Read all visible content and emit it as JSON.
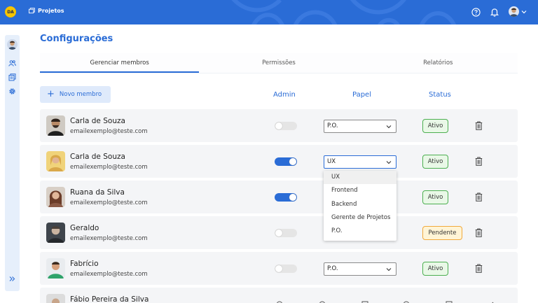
{
  "app": {
    "logo_text": "DA",
    "section": "Projetos"
  },
  "header": {
    "icons": [
      "help-circle-icon",
      "bell-icon",
      "user-avatar",
      "chevron-down-icon"
    ]
  },
  "sidebar": {
    "icons": [
      "user-avatar",
      "users-icon",
      "document-icon",
      "gear-icon",
      "double-chevron-right-icon"
    ]
  },
  "page": {
    "title": "Configurações"
  },
  "tabs": [
    {
      "label": "Gerenciar membros",
      "active": true
    },
    {
      "label": "Permissões",
      "active": false
    },
    {
      "label": "Relatórios",
      "active": false
    }
  ],
  "actions": {
    "add_member": "Novo membro"
  },
  "columns": {
    "admin": "Admin",
    "role": "Papel",
    "status": "Status"
  },
  "members": [
    {
      "name": "Carla de Souza",
      "email": "emailexemplo@teste.com",
      "admin": false,
      "role": "P.O.",
      "status": "Ativo"
    },
    {
      "name": "Carla de Souza",
      "email": "emailexemplo@teste.com",
      "admin": true,
      "role": "UX",
      "status": "Ativo"
    },
    {
      "name": "Ruana da Silva",
      "email": "emailexemplo@teste.com",
      "admin": true,
      "role": "",
      "status": "Ativo"
    },
    {
      "name": "Geraldo",
      "email": "emailexemplo@teste.com",
      "admin": false,
      "role": "",
      "status": "Pendente"
    },
    {
      "name": "Fabrício",
      "email": "emailexemplo@teste.com",
      "admin": false,
      "role": "P.O.",
      "status": "Ativo"
    },
    {
      "name": "Fábio Pereira da Silva",
      "email": "",
      "admin": null,
      "role": "",
      "status": ""
    }
  ],
  "role_dropdown": {
    "open_for_row": 1,
    "options": [
      "UX",
      "Frontend",
      "Backend",
      "Gerente de Projetos",
      "P.O."
    ],
    "highlighted": "UX"
  },
  "colors": {
    "primary": "#2a6cd6",
    "active_status_bg": "#e9f8e7",
    "active_status_border": "#4caf50",
    "pending_status_bg": "#fff4d6",
    "pending_status_border": "#f1a93b",
    "row_bg": "#f4f5f7"
  }
}
